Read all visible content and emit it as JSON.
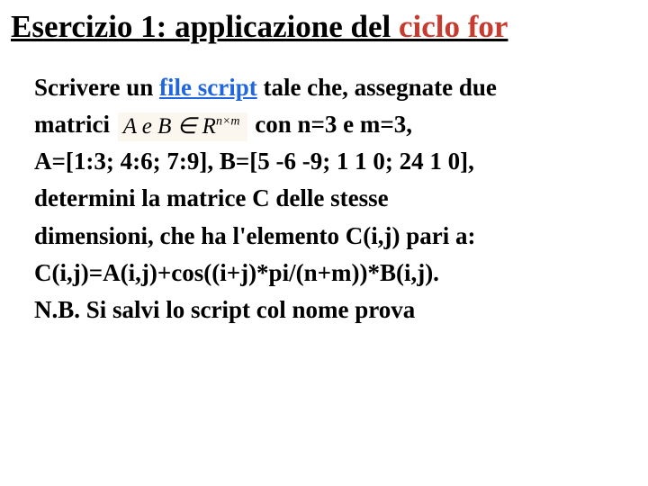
{
  "title": {
    "prefix": "Esercizio 1: applicazione del ",
    "accent": "ciclo for"
  },
  "body": {
    "line1a": "Scrivere un ",
    "line1b": "file script",
    "line1c": " tale che, assegnate due",
    "line2a": "matrici ",
    "formula_Ae": "A e ",
    "formula_Bin": "B ∈ R",
    "formula_sup": "n×m",
    "line2b": " con n=3 e m=3,",
    "line3": "A=[1:3; 4:6; 7:9], B=[5 -6 -9; 1 1 0; 24 1 0],",
    "line4": "determini la matrice C delle stesse",
    "line5": "dimensioni, che ha l'elemento C(i,j) pari a:",
    "line6": "C(i,j)=A(i,j)+cos((i+j)*pi/(n+m))*B(i,j).",
    "line7": "N.B. Si salvi lo script col nome prova"
  }
}
